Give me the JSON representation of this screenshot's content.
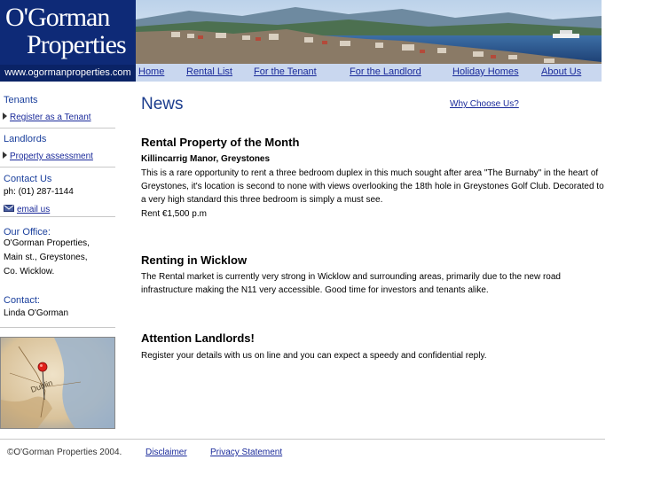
{
  "logo": {
    "line1": "O'Gorman",
    "line2": "Properties",
    "url": "www.ogormanproperties.com"
  },
  "nav": [
    {
      "label": "Home"
    },
    {
      "label": "Rental List"
    },
    {
      "label": "For the Tenant"
    },
    {
      "label": "For the Landlord"
    },
    {
      "label": "Holiday Homes"
    },
    {
      "label": "About Us"
    }
  ],
  "sidebar": {
    "tenants_heading": "Tenants",
    "register_link": "Register as a Tenant",
    "landlords_heading": "Landlords",
    "assessment_link": "Property assessment",
    "contact_heading": "Contact Us",
    "phone": "ph: (01) 287-1144",
    "email_link": "email us",
    "office_heading": "Our Office:",
    "office_line1": "O'Gorman Properties,",
    "office_line2": "Main st., Greystones,",
    "office_line3": "Co. Wicklow.",
    "contact2_heading": "Contact:",
    "contact_name": "Linda O'Gorman"
  },
  "main": {
    "title": "News",
    "why_link": "Why Choose Us?",
    "article1": {
      "heading": "Rental Property of the Month",
      "subheading": "Killincarrig Manor, Greystones",
      "body": "This is a rare opportunity to rent a three bedroom duplex in this much sought after area \"The Burnaby\" in the heart of Greystones, it's location is second to none with views overlooking the 18th hole in Greystones Golf Club. Decorated to a very high standard this three bedroom is simply a must see.",
      "rent": "Rent €1,500 p.m"
    },
    "article2": {
      "heading": "Renting in Wicklow",
      "body": "The Rental market is currently very strong in Wicklow and surrounding areas, primarily due to the new road infrastructure making the N11 very accessible. Good time for investors and tenants alike."
    },
    "article3": {
      "heading": "Attention Landlords!",
      "body": "Register your details with us on line and you can expect a speedy and confidential reply."
    }
  },
  "footer": {
    "copyright": "©O'Gorman Properties 2004.",
    "disclaimer": "Disclaimer",
    "privacy": "Privacy Statement"
  },
  "colors": {
    "brand": "#0e2a77",
    "nav_bg": "#c9d7ef",
    "link": "#1a2a9a",
    "heading": "#1c3d8e"
  },
  "icons": {
    "bullet": "arrow-right-icon",
    "email": "envelope-icon"
  }
}
